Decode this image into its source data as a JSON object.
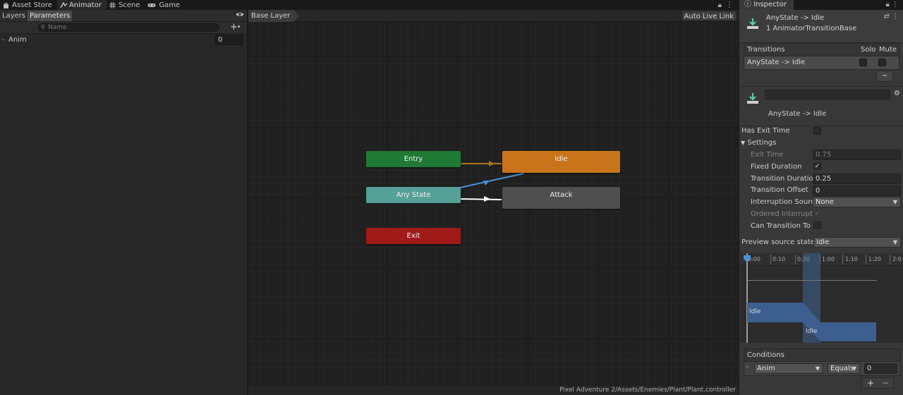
{
  "tabs": [
    {
      "label": "Asset Store",
      "icon": "bag-icon"
    },
    {
      "label": "Animator",
      "icon": "animator-icon"
    },
    {
      "label": "Scene",
      "icon": "grid-icon"
    },
    {
      "label": "Game",
      "icon": "gamepad-icon"
    }
  ],
  "left_pane": {
    "tab_layers": "Layers",
    "tab_parameters": "Parameters",
    "search_placeholder": "Name",
    "parameters": [
      {
        "name": "Anim",
        "value": "0"
      }
    ]
  },
  "graph": {
    "breadcrumb": "Base Layer",
    "auto_live_link": "Auto Live Link",
    "states": {
      "entry": "Entry",
      "idle": "Idle",
      "any_state": "Any State",
      "attack": "Attack",
      "exit": "Exit"
    },
    "footer_path": "Pixel Adventure 2/Assets/Enemies/Plant/Plant.controller",
    "colors": {
      "entry": "#1f7a35",
      "idle": "#c9741a",
      "any_state": "#55a097",
      "attack": "#4f4f4f",
      "exit": "#a01a1a",
      "link_blue": "#4a90d9",
      "link_orange": "#a8731a"
    }
  },
  "inspector": {
    "tab_label": "Inspector",
    "header_title": "AnyState -> Idle",
    "header_subtitle": "1 AnimatorTransitionBase",
    "transitions_label": "Transitions",
    "solo_label": "Solo",
    "mute_label": "Mute",
    "transition_row": "AnyState -> Idle",
    "minus_label": "−",
    "transition_name_field": "",
    "transition_caption": "AnyState -> Idle",
    "has_exit_time_label": "Has Exit Time",
    "settings_label": "Settings",
    "exit_time_label": "Exit Time",
    "exit_time_value": "0.75",
    "fixed_duration_label": "Fixed Duration",
    "fixed_duration_check": "✓",
    "transition_duration_label": "Transition Duration",
    "transition_duration_value": "0.25",
    "transition_offset_label": "Transition Offset",
    "transition_offset_value": "0",
    "interruption_source_label": "Interruption Source",
    "interruption_source_value": "None",
    "ordered_interruption_label": "Ordered Interruption",
    "ordered_interruption_check": "✓",
    "can_transition_to_label": "Can Transition To Self",
    "preview_source_label": "Preview source state",
    "preview_source_value": "Idle",
    "timeline_ticks": [
      "0:00",
      "0:10",
      "0:20",
      "1:00",
      "1:10",
      "1:20",
      "2:0"
    ],
    "timeline_clip_1": "Idle",
    "timeline_clip_2": "Idle",
    "conditions_label": "Conditions",
    "condition_param": "Anim",
    "condition_op": "Equals",
    "condition_value": "0",
    "plus_label": "+",
    "minus2_label": "−"
  }
}
